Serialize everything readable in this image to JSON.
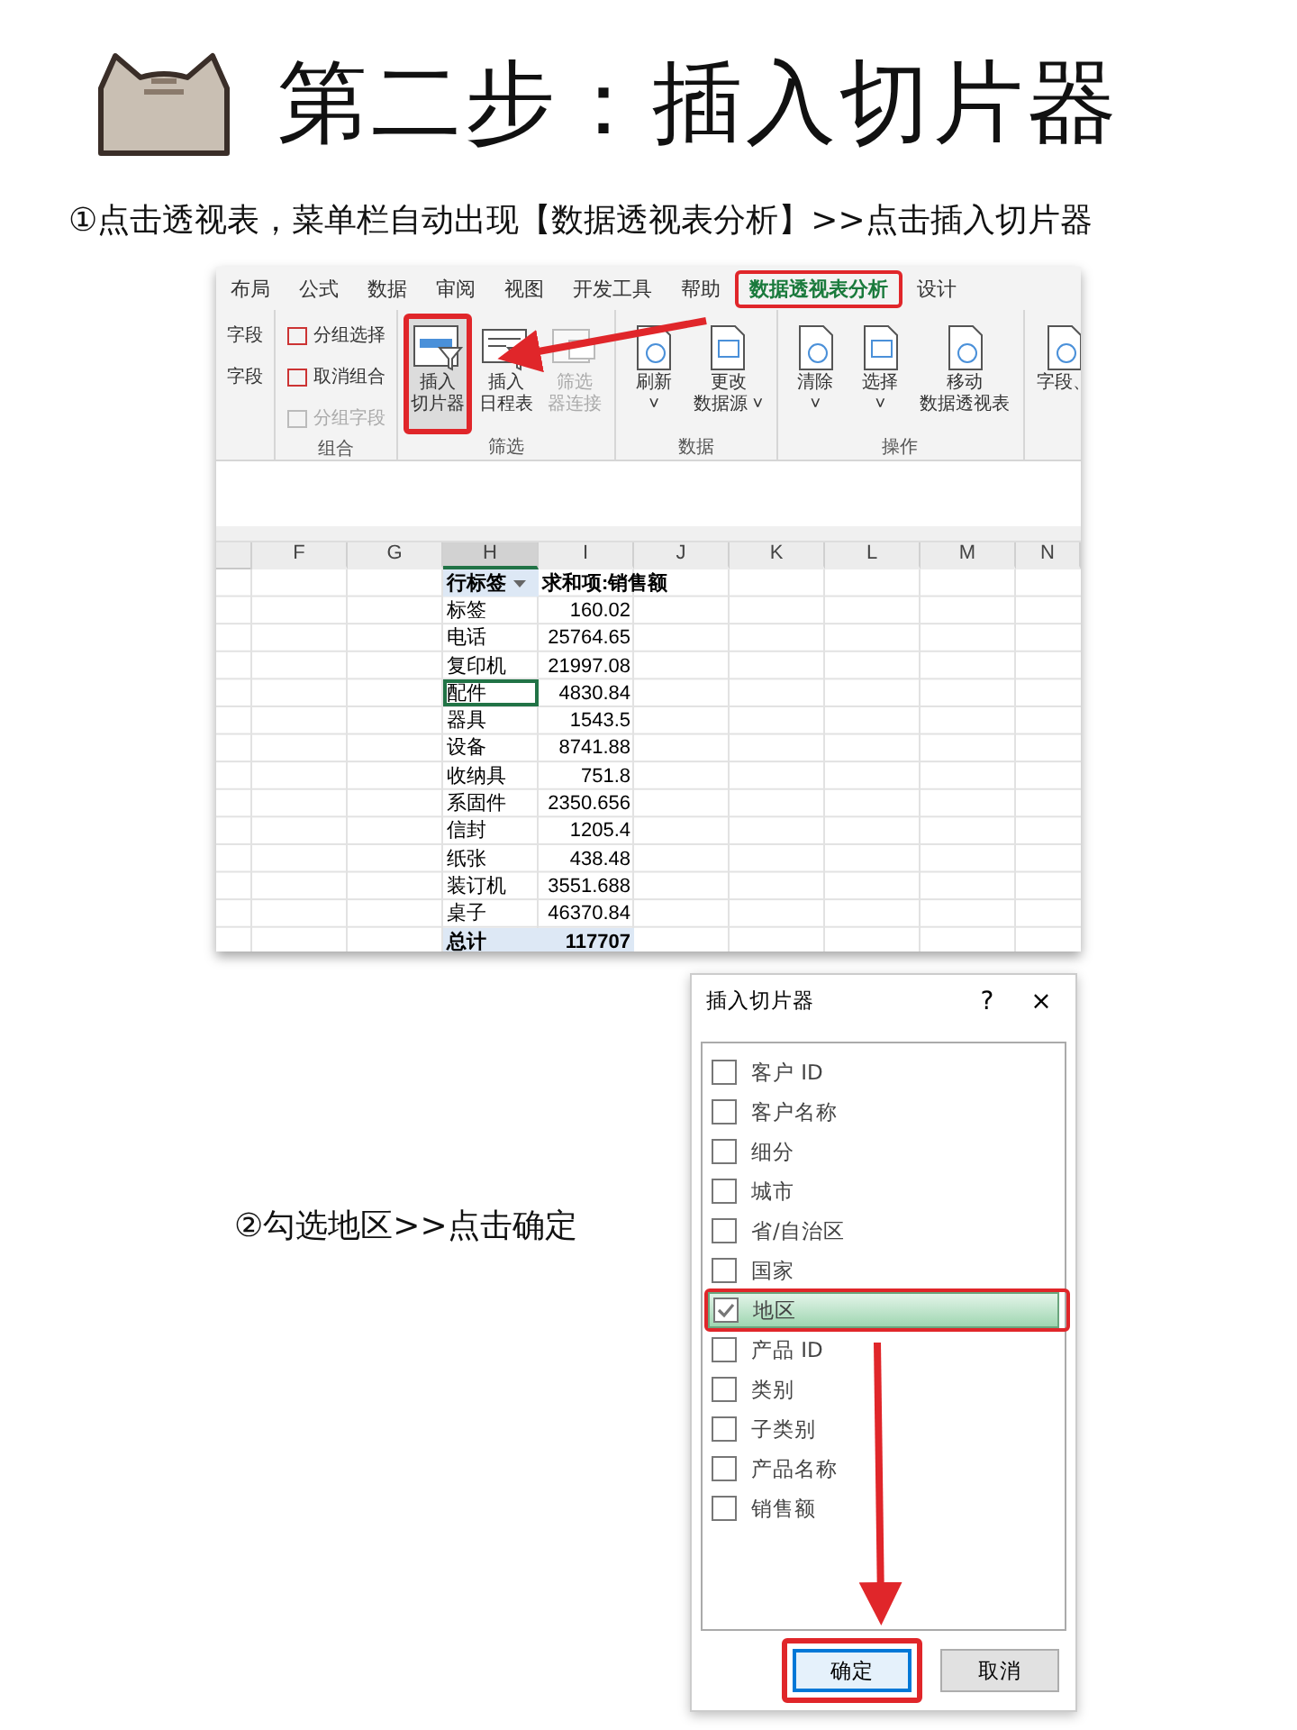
{
  "title": "第二步：插入切片器",
  "step_1": "①点击透视表，菜单栏自动出现【数据透视表分析】>>点击插入切片器",
  "excel": {
    "tabs": [
      {
        "label": "布局",
        "selected": false,
        "annotated": false
      },
      {
        "label": "公式",
        "selected": false,
        "annotated": false
      },
      {
        "label": "数据",
        "selected": false,
        "annotated": false
      },
      {
        "label": "审阅",
        "selected": false,
        "annotated": false
      },
      {
        "label": "视图",
        "selected": false,
        "annotated": false
      },
      {
        "label": "开发工具",
        "selected": false,
        "annotated": false
      },
      {
        "label": "帮助",
        "selected": false,
        "annotated": false
      },
      {
        "label": "数据透视表分析",
        "selected": true,
        "annotated": true
      },
      {
        "label": "设计",
        "selected": false,
        "annotated": false
      }
    ],
    "groups": [
      {
        "kind": "small",
        "items": [
          {
            "label": "字段",
            "disabled": false,
            "annotated": false
          },
          {
            "label": "字段",
            "disabled": false,
            "annotated": false
          }
        ]
      },
      {
        "kind": "small",
        "label": "组合",
        "items": [
          {
            "label": "分组选择",
            "disabled": false,
            "annotated": false
          },
          {
            "label": "取消组合",
            "disabled": false,
            "annotated": false
          },
          {
            "label": "分组字段",
            "disabled": true,
            "annotated": false
          }
        ]
      },
      {
        "kind": "large",
        "label": "筛选",
        "items": [
          {
            "label": "插入",
            "label_2": "切片器",
            "disabled": false,
            "annotated": true
          },
          {
            "label": "插入",
            "label_2": "日程表",
            "disabled": false,
            "annotated": false
          },
          {
            "label": "筛选",
            "label_2": "器连接",
            "disabled": true,
            "annotated": false
          }
        ]
      },
      {
        "kind": "large",
        "label": "数据",
        "items": [
          {
            "label": "刷新",
            "label_2": "˅",
            "disabled": false,
            "annotated": false
          },
          {
            "label": "更改",
            "label_2": "数据源 ˅",
            "disabled": false,
            "annotated": false
          }
        ]
      },
      {
        "kind": "large",
        "label": "操作",
        "items": [
          {
            "label": "清除",
            "label_2": "˅",
            "disabled": false,
            "annotated": false
          },
          {
            "label": "选择",
            "label_2": "˅",
            "disabled": false,
            "annotated": false
          },
          {
            "label": "移动",
            "label_2": "数据透视表",
            "disabled": false,
            "annotated": false
          }
        ]
      },
      {
        "kind": "large",
        "items": [
          {
            "label": "字段、",
            "disabled": false,
            "annotated": false
          }
        ]
      }
    ],
    "columns": [
      {
        "label": "F",
        "selected": false
      },
      {
        "label": "G",
        "selected": false
      },
      {
        "label": "H",
        "selected": true
      },
      {
        "label": "I",
        "selected": false
      },
      {
        "label": "J",
        "selected": false
      },
      {
        "label": "K",
        "selected": false
      },
      {
        "label": "L",
        "selected": false
      },
      {
        "label": "M",
        "selected": false
      },
      {
        "label": "N",
        "selected": false
      }
    ],
    "pivot_header": {
      "row_label": "行标签",
      "value_label": "求和项:销售额"
    },
    "rows": [
      {
        "label": "标签",
        "value": "160.02",
        "selected": false
      },
      {
        "label": "电话",
        "value": "25764.65",
        "selected": false
      },
      {
        "label": "复印机",
        "value": "21997.08",
        "selected": false
      },
      {
        "label": "配件",
        "value": "4830.84",
        "selected": true
      },
      {
        "label": "器具",
        "value": "1543.5",
        "selected": false
      },
      {
        "label": "设备",
        "value": "8741.88",
        "selected": false
      },
      {
        "label": "收纳具",
        "value": "751.8",
        "selected": false
      },
      {
        "label": "系固件",
        "value": "2350.656",
        "selected": false
      },
      {
        "label": "信封",
        "value": "1205.4",
        "selected": false
      },
      {
        "label": "纸张",
        "value": "438.48",
        "selected": false
      },
      {
        "label": "装订机",
        "value": "3551.688",
        "selected": false
      },
      {
        "label": "桌子",
        "value": "46370.84",
        "selected": false
      }
    ],
    "total": {
      "label": "总计",
      "value": "117707"
    }
  },
  "step_2": "②勾选地区>>点击确定",
  "dialog": {
    "title": "插入切片器",
    "help": "?",
    "close": "×",
    "fields": [
      {
        "label": "客户 ID",
        "checked": false,
        "selected": false,
        "annotated": false
      },
      {
        "label": "客户名称",
        "checked": false,
        "selected": false,
        "annotated": false
      },
      {
        "label": "细分",
        "checked": false,
        "selected": false,
        "annotated": false
      },
      {
        "label": "城市",
        "checked": false,
        "selected": false,
        "annotated": false
      },
      {
        "label": "省/自治区",
        "checked": false,
        "selected": false,
        "annotated": false
      },
      {
        "label": "国家",
        "checked": false,
        "selected": false,
        "annotated": false
      },
      {
        "label": "地区",
        "checked": true,
        "selected": true,
        "annotated": true
      },
      {
        "label": "产品 ID",
        "checked": false,
        "selected": false,
        "annotated": false
      },
      {
        "label": "类别",
        "checked": false,
        "selected": false,
        "annotated": false
      },
      {
        "label": "子类别",
        "checked": false,
        "selected": false,
        "annotated": false
      },
      {
        "label": "产品名称",
        "checked": false,
        "selected": false,
        "annotated": false
      },
      {
        "label": "销售额",
        "checked": false,
        "selected": false,
        "annotated": false
      }
    ],
    "buttons": [
      {
        "label": "确定",
        "default": true,
        "annotated": true
      },
      {
        "label": "取消",
        "default": false,
        "annotated": false
      }
    ]
  }
}
